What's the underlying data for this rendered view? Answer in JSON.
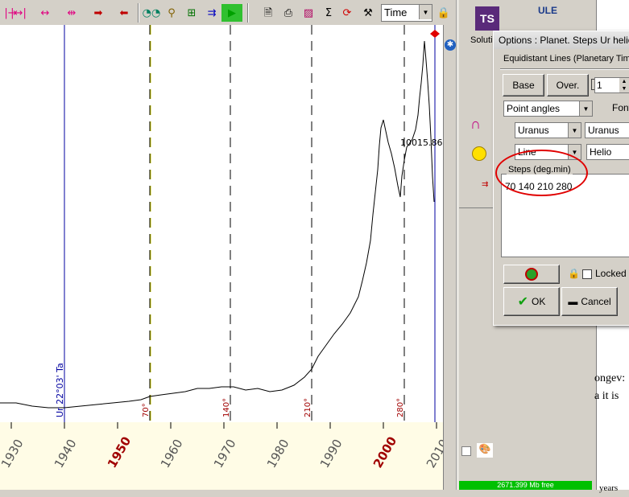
{
  "toolbar": {
    "time_select": "Time"
  },
  "chart": {
    "value_label": "10015.86",
    "vline_label": "Ur 22°03' Ta",
    "step_labels": [
      "70°",
      "140°",
      "210°",
      "280°"
    ],
    "year_ticks": [
      "1930",
      "1940",
      "1950",
      "1960",
      "1970",
      "1980",
      "1990",
      "2000",
      "2010"
    ],
    "bold_years": [
      "1950",
      "2000"
    ],
    "colors": {
      "accent_line": "#0000a0",
      "step_label": "#a00000",
      "guide_line": "#c8c800"
    }
  },
  "right_panel": {
    "solution_label": "Soluti",
    "ts_icon": "TS",
    "ule_icon": "ULE",
    "status_text": "2671.399 Mb free"
  },
  "dialog": {
    "title": "Options : Planet. Steps  Ur helio",
    "tab": "Equidistant Lines (Planetary Time",
    "base_button": "Base",
    "over_button": "Over.",
    "spin_value": "1",
    "angles_select": "Point angles",
    "font_label": "Font",
    "planet_select": "Uranus",
    "planet_select2": "Uranus",
    "line_select": "Line",
    "helio_field": "Helio",
    "steps_label": "Steps (deg.min)",
    "steps_value": "70 140 210 280",
    "locked_label": "Locked",
    "ok_button": "OK",
    "cancel_button": "Cancel"
  },
  "document": {
    "line1": "ongev:",
    "line2": "a it is",
    "line3": "years"
  }
}
